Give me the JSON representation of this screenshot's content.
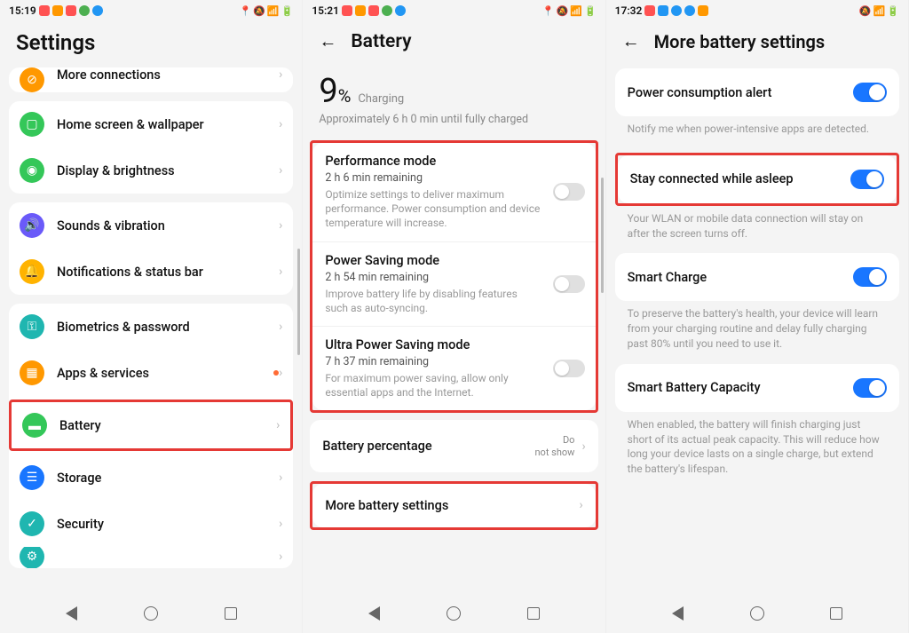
{
  "screen1": {
    "time": "15:19",
    "title": "Settings",
    "groups": [
      {
        "items": [
          {
            "icon": "link-icon",
            "color": "#ff9800",
            "label": "More connections",
            "cut": "top"
          }
        ]
      },
      {
        "items": [
          {
            "icon": "home-icon",
            "color": "#34c759",
            "label": "Home screen & wallpaper"
          },
          {
            "icon": "eye-icon",
            "color": "#34c759",
            "label": "Display & brightness"
          }
        ]
      },
      {
        "items": [
          {
            "icon": "sound-icon",
            "color": "#6a5af9",
            "label": "Sounds & vibration"
          },
          {
            "icon": "bell-icon",
            "color": "#ffb300",
            "label": "Notifications & status bar"
          }
        ]
      },
      {
        "items": [
          {
            "icon": "key-icon",
            "color": "#1fb6b0",
            "label": "Biometrics & password"
          },
          {
            "icon": "apps-icon",
            "color": "#ff9800",
            "label": "Apps & services",
            "badge": true
          },
          {
            "icon": "battery-icon",
            "color": "#34c759",
            "label": "Battery",
            "highlight": true
          },
          {
            "icon": "storage-icon",
            "color": "#1976ff",
            "label": "Storage"
          },
          {
            "icon": "shield-icon",
            "color": "#1fb6b0",
            "label": "Security"
          },
          {
            "icon": "privacy-icon",
            "color": "#1fb6b0",
            "label": "",
            "cut": "bottom"
          }
        ]
      }
    ]
  },
  "screen2": {
    "time": "15:21",
    "title": "Battery",
    "percent": "9",
    "percent_unit": "%",
    "charging_label": "Charging",
    "estimate": "Approximately 6 h 0 min until fully charged",
    "modes": [
      {
        "title": "Performance mode",
        "sub": "2 h 6 min remaining",
        "desc": "Optimize settings to deliver maximum performance. Power consumption and device temperature will increase.",
        "on": false
      },
      {
        "title": "Power Saving mode",
        "sub": "2 h 54 min remaining",
        "desc": "Improve battery life by disabling features such as auto-syncing.",
        "on": false
      },
      {
        "title": "Ultra Power Saving mode",
        "sub": "7 h 37 min remaining",
        "desc": "For maximum power saving, allow only essential apps and the Internet.",
        "on": false
      }
    ],
    "battery_percentage_label": "Battery percentage",
    "battery_percentage_value": "Do not show",
    "more_label": "More battery settings"
  },
  "screen3": {
    "time": "17:32",
    "title": "More battery settings",
    "items": [
      {
        "label": "Power consumption alert",
        "on": true,
        "helper": "Notify me when power-intensive apps are detected."
      },
      {
        "label": "Stay connected while asleep",
        "on": true,
        "helper": "Your WLAN or mobile data connection will stay on after the screen turns off.",
        "highlight": true
      },
      {
        "label": "Smart Charge",
        "on": true,
        "helper": "To preserve the battery's health, your device will learn from your charging routine and delay fully charging past 80% until you need to use it."
      },
      {
        "label": "Smart Battery Capacity",
        "on": true,
        "helper": "When enabled, the battery will finish charging just short of its actual peak capacity. This will reduce how long your device lasts on a single charge, but extend the battery's lifespan."
      }
    ]
  }
}
